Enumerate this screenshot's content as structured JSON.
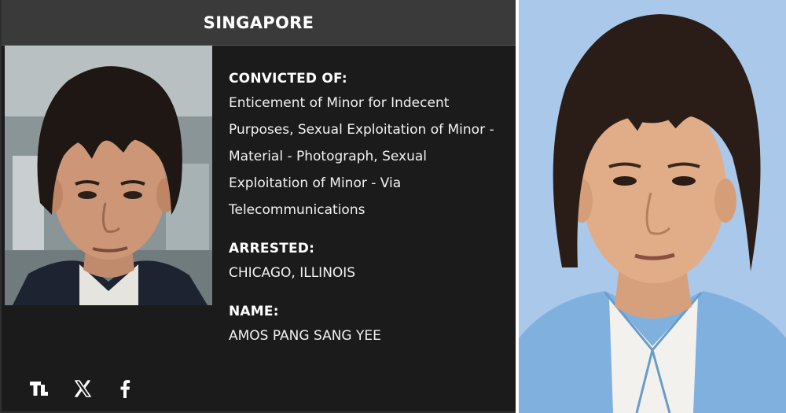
{
  "card": {
    "header_title": "SINGAPORE",
    "convicted_label": "CONVICTED OF:",
    "convicted_value": "Enticement of Minor for Indecent Purposes, Sexual Exploitation of Minor - Material - Photograph, Sexual Exploitation of Minor - Via Telecommunications",
    "arrested_label": "ARRESTED:",
    "arrested_value": "CHICAGO, ILLINOIS",
    "name_label": "NAME:",
    "name_value": "AMOS PANG SANG YEE"
  },
  "share": {
    "icons": [
      "brand-logo-icon",
      "x-twitter-icon",
      "facebook-icon"
    ]
  },
  "colors": {
    "card_bg": "#1b1b1b",
    "header_bg": "#3a3a3a",
    "text": "#ffffff",
    "mugshot_bg": "#a9c8ea",
    "shirt": "#7fb0de"
  }
}
